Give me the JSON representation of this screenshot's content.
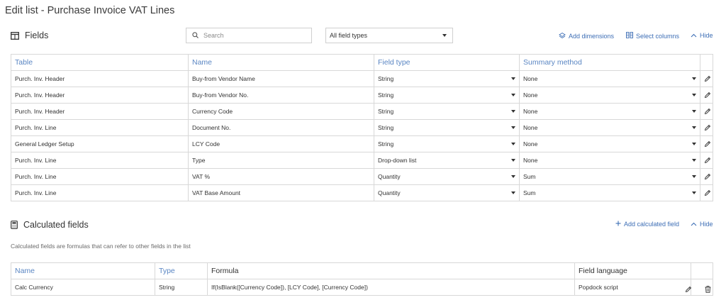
{
  "page": {
    "title": "Edit list - Purchase Invoice VAT Lines"
  },
  "fields": {
    "heading": "Fields",
    "search_placeholder": "Search",
    "field_type_filter": "All field types",
    "add_dimensions": "Add dimensions",
    "select_columns": "Select columns",
    "hide": "Hide",
    "columns": {
      "table": "Table",
      "name": "Name",
      "field_type": "Field type",
      "summary_method": "Summary method"
    },
    "rows": [
      {
        "table": "Purch. Inv. Header",
        "name": "Buy-from Vendor Name",
        "field_type": "String",
        "summary_method": "None"
      },
      {
        "table": "Purch. Inv. Header",
        "name": "Buy-from Vendor No.",
        "field_type": "String",
        "summary_method": "None"
      },
      {
        "table": "Purch. Inv. Header",
        "name": "Currency Code",
        "field_type": "String",
        "summary_method": "None"
      },
      {
        "table": "Purch. Inv. Line",
        "name": "Document No.",
        "field_type": "String",
        "summary_method": "None"
      },
      {
        "table": "General Ledger Setup",
        "name": "LCY Code",
        "field_type": "String",
        "summary_method": "None"
      },
      {
        "table": "Purch. Inv. Line",
        "name": "Type",
        "field_type": "Drop-down list",
        "summary_method": "None"
      },
      {
        "table": "Purch. Inv. Line",
        "name": "VAT %",
        "field_type": "Quantity",
        "summary_method": "Sum"
      },
      {
        "table": "Purch. Inv. Line",
        "name": "VAT Base Amount",
        "field_type": "Quantity",
        "summary_method": "Sum"
      }
    ]
  },
  "calculated": {
    "heading": "Calculated fields",
    "add_calculated_field": "Add calculated field",
    "hide": "Hide",
    "description": "Calculated fields are formulas that can refer to other fields in the list",
    "columns": {
      "name": "Name",
      "type": "Type",
      "formula": "Formula",
      "field_language": "Field language"
    },
    "rows": [
      {
        "name": "Calc Currency",
        "type": "String",
        "formula": "If(IsBlank([Currency Code]), [LCY Code], [Currency Code])",
        "field_language": "Popdock script"
      }
    ]
  },
  "icons": {
    "fields_section": "table-icon",
    "calculated_section": "calculator-icon",
    "search": "search-icon",
    "add_dimensions": "dimensions-icon",
    "select_columns": "columns-icon",
    "hide": "chevron-up-icon",
    "edit": "pencil-icon",
    "delete": "trash-icon",
    "add": "plus-icon"
  },
  "colors": {
    "link": "#3d6eb5",
    "header_text": "#5a86c3",
    "border": "#d8d8d8"
  }
}
